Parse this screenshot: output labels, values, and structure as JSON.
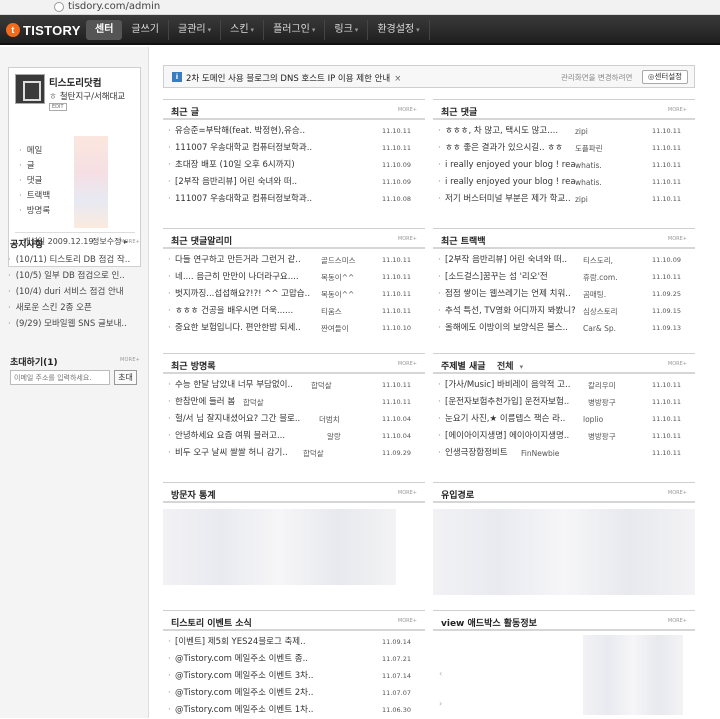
{
  "browser": {
    "url": "tisdory.com/admin"
  },
  "nav": {
    "logo": "TISTORY",
    "logo_mark": "t",
    "items": [
      {
        "label": "센터",
        "caret": ""
      },
      {
        "label": "글쓰기",
        "caret": ""
      },
      {
        "label": "글관리",
        "caret": "▾"
      },
      {
        "label": "스킨",
        "caret": "▾"
      },
      {
        "label": "플러그인",
        "caret": "▾"
      },
      {
        "label": "링크",
        "caret": "▾"
      },
      {
        "label": "환경설정",
        "caret": "▾"
      }
    ]
  },
  "profile": {
    "blog_name": "티스도리닷컴",
    "owner": "철탄지구/서해대교",
    "edit": "EDIT",
    "stats": [
      "메일",
      "글",
      "댓글",
      "트랙백",
      "방명록"
    ],
    "opened": "개설일 2009.12.19",
    "info": "정보수정 ▸"
  },
  "notice": {
    "title": "공지사항",
    "more": "MORE+",
    "items": [
      "(10/11) 티스토리 DB 점검 작..",
      "(10/5) 일부 DB 점검으로 인..",
      "(10/4) duri 서비스 점검 안내",
      "새로운 스킨 2종 오픈",
      "(9/29) 모바일웹 SNS 글보내.."
    ]
  },
  "invite": {
    "title": "초대하기",
    "count": "(1)",
    "more": "MORE+",
    "placeholder": "이메일 주소를 입력하세요.",
    "button": "초대"
  },
  "banner": {
    "icon": "i",
    "text": "2차 도메인 사용 블로그의 DNS 호스트 IP 이용 제한 안내",
    "close": "×",
    "hint": "관리화면을 변경하려면",
    "button": "◎센터설정"
  },
  "panels": {
    "recent_posts": {
      "title": "최근 글",
      "more": "MORE+",
      "rows": [
        {
          "text": "유승준=부탁해(feat. 박정현),유승..",
          "date": "11.10.11"
        },
        {
          "text": "111007 우송대학교 컴퓨터정보학과..",
          "date": "11.10.11"
        },
        {
          "text": "초대장 배포 (10일 오후 6시까지)",
          "date": "11.10.09"
        },
        {
          "text": "[2부작 음반리뷰] 어린 숙녀와 떠..",
          "date": "11.10.09"
        },
        {
          "text": "111007 우송대학교 컴퓨터정보학과..",
          "date": "11.10.08"
        }
      ]
    },
    "recent_comments": {
      "title": "최근 댓글",
      "more": "MORE+",
      "rows": [
        {
          "text": "ㅎㅎㅎ, 차 많고, 택시도 많고....",
          "author": "zipi",
          "date": "11.10.11"
        },
        {
          "text": "ㅎㅎ 좋은 결과가 있으시길.. ㅎㅎ",
          "author": "도플파린",
          "date": "11.10.11"
        },
        {
          "text": "i really enjoyed your blog ! rea..",
          "author": "whatis.",
          "date": "11.10.11"
        },
        {
          "text": "i really enjoyed your blog ! rea..",
          "author": "whatis.",
          "date": "11.10.11"
        },
        {
          "text": "저기 버스터미널 부분은 제가 학교..",
          "author": "zipi",
          "date": "11.10.11"
        }
      ]
    },
    "comment_alerts": {
      "title": "최근 댓글알리미",
      "more": "MORE+",
      "rows": [
        {
          "text": "다들 연구하고 만든거라 그런거 같..",
          "author": "골드스미스",
          "date": "11.10.11"
        },
        {
          "text": "네.... 음근히 만만이 나더라구요....",
          "author": "복동이^^",
          "date": "11.10.11"
        },
        {
          "text": "벗지까징...섭섭해요?!?! ^^ 고맙습..",
          "author": "복동이^^",
          "date": "11.10.11"
        },
        {
          "text": "ㅎㅎㅎ 건공을 배우시면 더욱......",
          "author": "티움스",
          "date": "11.10.11"
        },
        {
          "text": "중요한 보험입니다. 편안한밤 되세..",
          "author": "짠여들이",
          "date": "11.10.10"
        }
      ]
    },
    "recent_trackbacks": {
      "title": "최근 트랙백",
      "more": "MORE+",
      "rows": [
        {
          "text": "[2부작 음반리뷰] 어린 숙녀와 떠..",
          "author": "티스도리,",
          "date": "11.10.09"
        },
        {
          "text": "[소드걸스]꿈꾸는 섬 '리오'전",
          "author": "휴람.com.",
          "date": "11.10.11"
        },
        {
          "text": "점점 쌓이는 웹쓰레기는 언제 치워..",
          "author": "곰매팅.",
          "date": "11.09.25"
        },
        {
          "text": "추석 특선, TV영화 어디까지 봐봤니?",
          "author": "심상스토리",
          "date": "11.09.15"
        },
        {
          "text": "올해에도 이방이의 보양식은 불스..",
          "author": "Car& Sp.",
          "date": "11.09.13"
        }
      ]
    },
    "guestbook": {
      "title": "최근 방명록",
      "more": "MORE+",
      "rows": [
        {
          "text": "수능 한달 남았내 너무 부담없이..",
          "author": "합덕살",
          "date": "11.10.11"
        },
        {
          "text": "한참만에 들러 봄",
          "author": "합덕살",
          "date": "11.10.11"
        },
        {
          "text": "헐/서 님 잘지내셨어요? 그간 블로..",
          "author": "더범치",
          "date": "11.10.04"
        },
        {
          "text": "안녕하세요 요즘 여뭐 블러고...",
          "author": "알랑",
          "date": "11.10.04"
        },
        {
          "text": "비두 오구 날씨 쌀쌀 허니 감기..",
          "author": "합덕살",
          "date": "11.09.29"
        }
      ]
    },
    "topic_posts": {
      "title": "주제별 새글",
      "more": "MORE+",
      "select": "전체",
      "rows": [
        {
          "text": "[가사/Music] 바비레이 음악적 고..",
          "author": "칼리우미",
          "date": "11.10.11"
        },
        {
          "text": "[운전자보험추천가입] 운전자보험..",
          "author": "병방팡구",
          "date": "11.10.11"
        },
        {
          "text": "눈요기 사진,★ 이름텝스 잭슨 라..",
          "author": "loplio",
          "date": "11.10.11"
        },
        {
          "text": "[에이아이지생명] 에이아이지생명..",
          "author": "병방팡구",
          "date": "11.10.11"
        },
        {
          "text": "인생극장합정비트",
          "author": "FinNewbie",
          "date": "11.10.11"
        }
      ]
    },
    "visitor_stats": {
      "title": "방문자 통계",
      "more": "MORE+"
    },
    "referrers": {
      "title": "유입경로",
      "more": "MORE+"
    },
    "events": {
      "title": "티스토리 이벤트 소식",
      "more": "MORE+",
      "rows": [
        {
          "text": "[이벤트] 제5회 YES24블로그 축제..",
          "date": "11.09.14"
        },
        {
          "text": "@Tistory.com 메일주소 이벤트 종..",
          "date": "11.07.21"
        },
        {
          "text": "@Tistory.com 메일주소 이벤트 3차..",
          "date": "11.07.14"
        },
        {
          "text": "@Tistory.com 메일주소 이벤트 2차..",
          "date": "11.07.07"
        },
        {
          "text": "@Tistory.com 메일주소 이벤트 1차..",
          "date": "11.06.30"
        }
      ]
    },
    "view_adbox": {
      "title": "view 애드박스 활동정보",
      "more": "MORE+",
      "marks": [
        "‹",
        "›"
      ]
    }
  }
}
